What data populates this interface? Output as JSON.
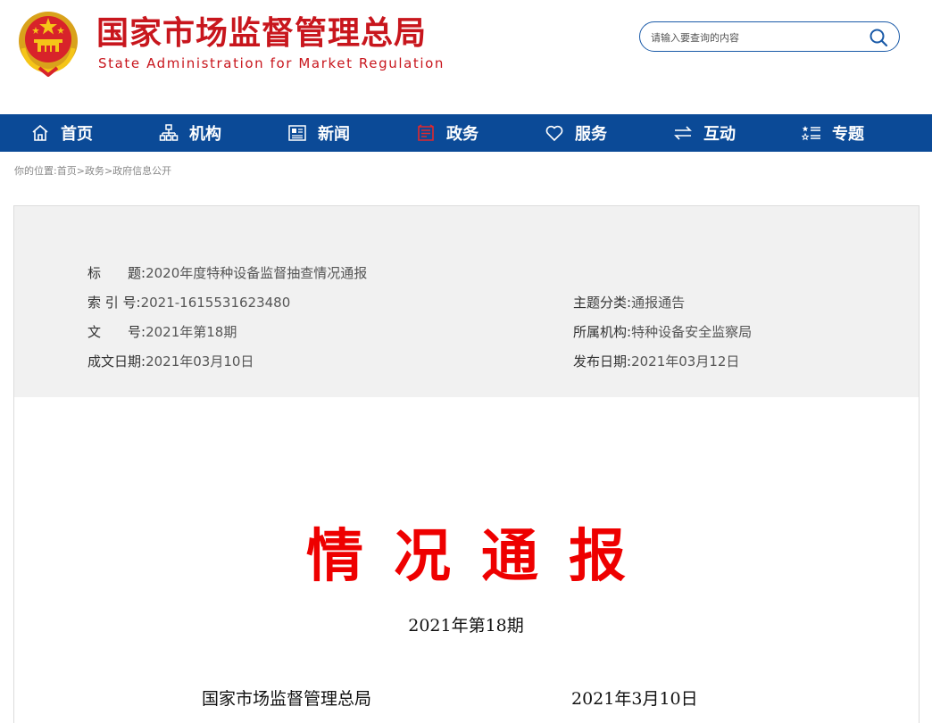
{
  "header": {
    "title": "国家市场监督管理总局",
    "subtitle": "State Administration for Market Regulation",
    "search_placeholder": "请输入要查询的内容"
  },
  "nav": {
    "items": [
      {
        "label": "首页",
        "icon": "home-icon"
      },
      {
        "label": "机构",
        "icon": "org-chart-icon"
      },
      {
        "label": "新闻",
        "icon": "newspaper-icon"
      },
      {
        "label": "政务",
        "icon": "government-affairs-icon"
      },
      {
        "label": "服务",
        "icon": "heart-icon"
      },
      {
        "label": "互动",
        "icon": "exchange-arrows-icon"
      },
      {
        "label": "专题",
        "icon": "list-stars-icon"
      }
    ],
    "active": "政务",
    "colors": {
      "background": "#0b4a97",
      "active_icon": "#e0282e",
      "text": "#ffffff"
    }
  },
  "breadcrumb": {
    "prefix": "你的位置:",
    "items": [
      "首页",
      "政务",
      "政府信息公开"
    ],
    "separator": ">"
  },
  "meta": {
    "title_label": "标　　题:",
    "title_value": "2020年度特种设备监督抽查情况通报",
    "index_label": "索 引 号:",
    "index_value": "2021-1615531623480",
    "topic_label": "主题分类:",
    "topic_value": "通报通告",
    "docno_label": "文　　号:",
    "docno_value": "2021年第18期",
    "org_label": "所属机构:",
    "org_value": "特种设备安全监察局",
    "created_label": "成文日期:",
    "created_value": "2021年03月10日",
    "published_label": "发布日期:",
    "published_value": "2021年03月12日"
  },
  "document": {
    "heading": "情况通报",
    "issue": "2021年第18期",
    "issuer": "国家市场监督管理总局",
    "date": "2021年3月10日",
    "heading_color": "#ee0000"
  },
  "colors": {
    "brand_red": "#c8161d",
    "brand_blue": "#0b4a97"
  }
}
